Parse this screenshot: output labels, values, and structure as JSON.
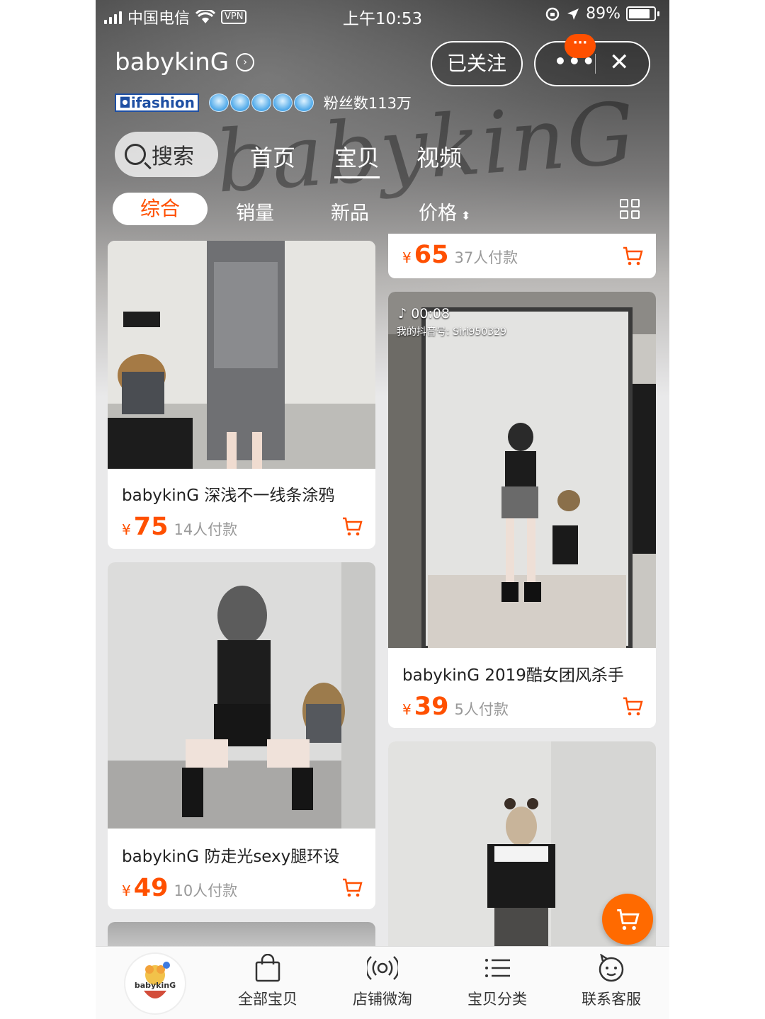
{
  "status_bar": {
    "carrier": "中国电信",
    "vpn": "VPN",
    "time": "上午10:53",
    "battery": "89%"
  },
  "shop": {
    "name": "babykinG",
    "follow_label": "已关注",
    "badge_text": "···",
    "brand_tag": "ifashion",
    "fans": "粉丝数113万",
    "watermark": "babykinG"
  },
  "nav": {
    "search_label": "搜索",
    "tabs": [
      "首页",
      "宝贝",
      "视频"
    ],
    "active_tab": "宝贝"
  },
  "sort": {
    "items": [
      "综合",
      "销量",
      "新品",
      "价格"
    ],
    "active": "综合"
  },
  "products": [
    {
      "title": "",
      "currency": "¥",
      "price": "65",
      "sold": "37人付款"
    },
    {
      "title": "babykinG 深浅不一线条涂鸦",
      "currency": "¥",
      "price": "75",
      "sold": "14人付款"
    },
    {
      "title": "babykinG 2019酷女团风杀手",
      "currency": "¥",
      "price": "39",
      "sold": "5人付款",
      "video_time": "00:08",
      "video_caption": "我的抖音号: Siri950329"
    },
    {
      "title": "babykinG 防走光sexy腿环设",
      "currency": "¥",
      "price": "49",
      "sold": "10人付款"
    }
  ],
  "tabbar": {
    "avatar_text": "babykinG",
    "items": [
      "全部宝贝",
      "店铺微淘",
      "宝贝分类",
      "联系客服"
    ]
  },
  "colors": {
    "accent": "#ff5000",
    "fab": "#ff6a00"
  }
}
